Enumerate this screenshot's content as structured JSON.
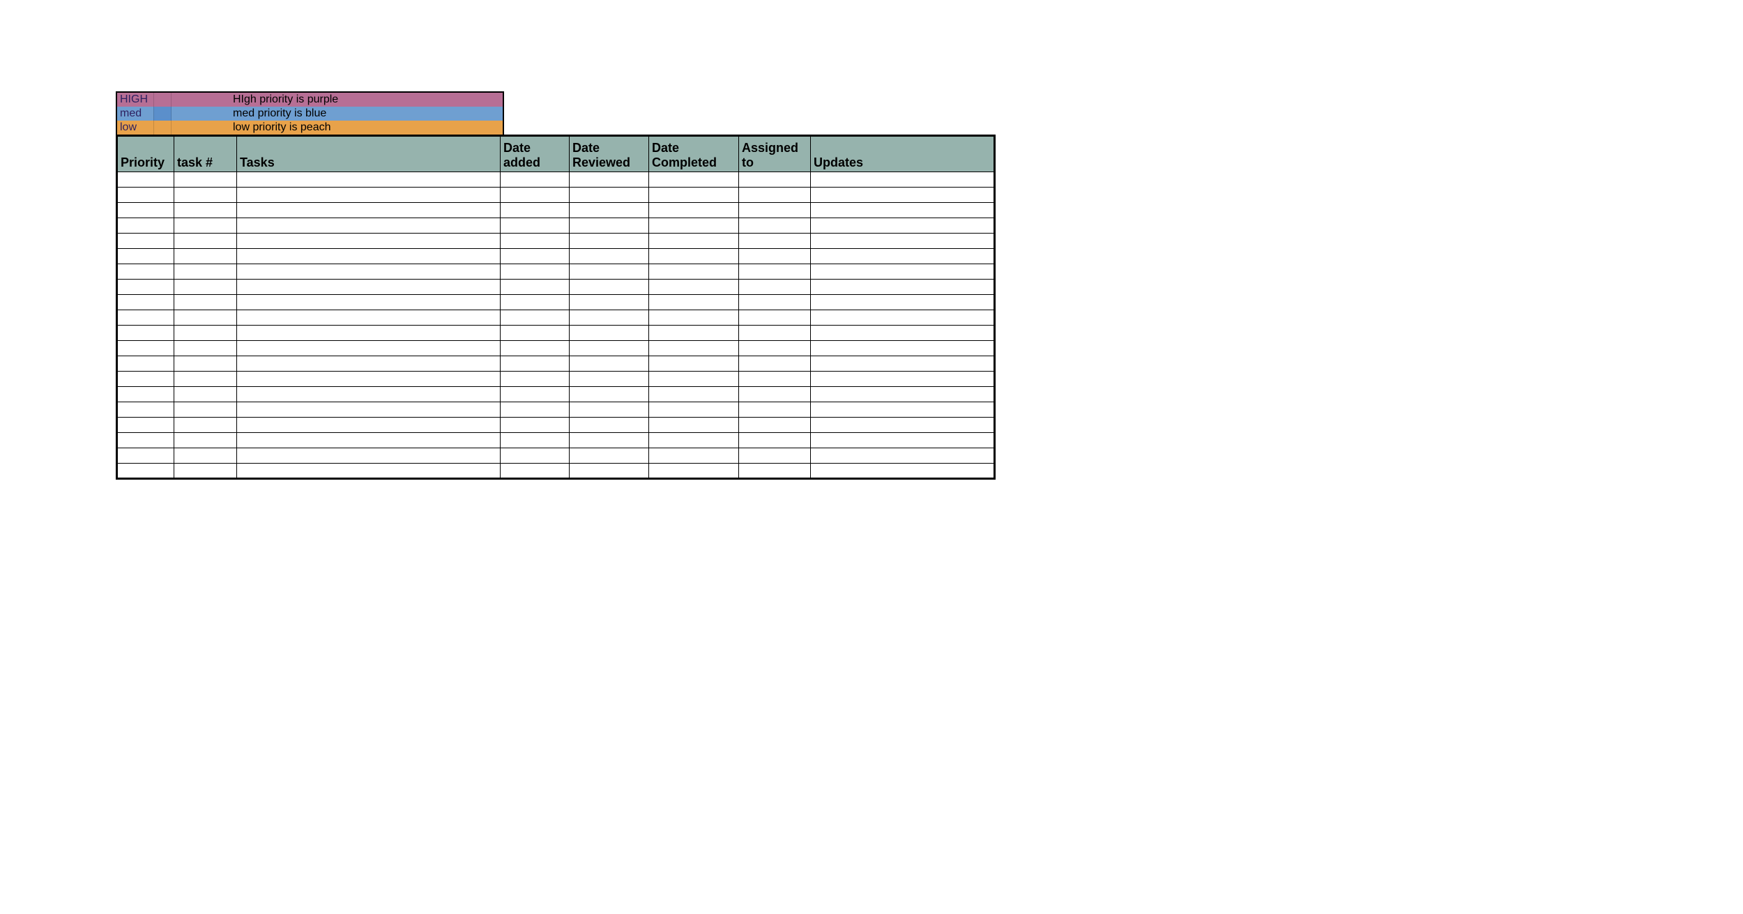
{
  "legend": {
    "high": {
      "label": "HIGH",
      "description": "HIgh priority is purple"
    },
    "med": {
      "label": "med",
      "description": "med priority is blue"
    },
    "low": {
      "label": "low",
      "description": "low priority is peach"
    }
  },
  "columns": {
    "priority": "Priority",
    "task_num": "task #",
    "tasks": "Tasks",
    "date_added": "Date added",
    "date_reviewed": "Date Reviewed",
    "date_completed": "Date Completed",
    "assigned_to": "Assigned to",
    "updates": "Updates"
  },
  "rows": [
    {
      "priority": "",
      "task_num": "",
      "tasks": "",
      "date_added": "",
      "date_reviewed": "",
      "date_completed": "",
      "assigned_to": "",
      "updates": ""
    },
    {
      "priority": "",
      "task_num": "",
      "tasks": "",
      "date_added": "",
      "date_reviewed": "",
      "date_completed": "",
      "assigned_to": "",
      "updates": ""
    },
    {
      "priority": "",
      "task_num": "",
      "tasks": "",
      "date_added": "",
      "date_reviewed": "",
      "date_completed": "",
      "assigned_to": "",
      "updates": ""
    },
    {
      "priority": "",
      "task_num": "",
      "tasks": "",
      "date_added": "",
      "date_reviewed": "",
      "date_completed": "",
      "assigned_to": "",
      "updates": ""
    },
    {
      "priority": "",
      "task_num": "",
      "tasks": "",
      "date_added": "",
      "date_reviewed": "",
      "date_completed": "",
      "assigned_to": "",
      "updates": ""
    },
    {
      "priority": "",
      "task_num": "",
      "tasks": "",
      "date_added": "",
      "date_reviewed": "",
      "date_completed": "",
      "assigned_to": "",
      "updates": ""
    },
    {
      "priority": "",
      "task_num": "",
      "tasks": "",
      "date_added": "",
      "date_reviewed": "",
      "date_completed": "",
      "assigned_to": "",
      "updates": ""
    },
    {
      "priority": "",
      "task_num": "",
      "tasks": "",
      "date_added": "",
      "date_reviewed": "",
      "date_completed": "",
      "assigned_to": "",
      "updates": ""
    },
    {
      "priority": "",
      "task_num": "",
      "tasks": "",
      "date_added": "",
      "date_reviewed": "",
      "date_completed": "",
      "assigned_to": "",
      "updates": ""
    },
    {
      "priority": "",
      "task_num": "",
      "tasks": "",
      "date_added": "",
      "date_reviewed": "",
      "date_completed": "",
      "assigned_to": "",
      "updates": ""
    },
    {
      "priority": "",
      "task_num": "",
      "tasks": "",
      "date_added": "",
      "date_reviewed": "",
      "date_completed": "",
      "assigned_to": "",
      "updates": ""
    },
    {
      "priority": "",
      "task_num": "",
      "tasks": "",
      "date_added": "",
      "date_reviewed": "",
      "date_completed": "",
      "assigned_to": "",
      "updates": ""
    },
    {
      "priority": "",
      "task_num": "",
      "tasks": "",
      "date_added": "",
      "date_reviewed": "",
      "date_completed": "",
      "assigned_to": "",
      "updates": ""
    },
    {
      "priority": "",
      "task_num": "",
      "tasks": "",
      "date_added": "",
      "date_reviewed": "",
      "date_completed": "",
      "assigned_to": "",
      "updates": ""
    },
    {
      "priority": "",
      "task_num": "",
      "tasks": "",
      "date_added": "",
      "date_reviewed": "",
      "date_completed": "",
      "assigned_to": "",
      "updates": ""
    },
    {
      "priority": "",
      "task_num": "",
      "tasks": "",
      "date_added": "",
      "date_reviewed": "",
      "date_completed": "",
      "assigned_to": "",
      "updates": ""
    },
    {
      "priority": "",
      "task_num": "",
      "tasks": "",
      "date_added": "",
      "date_reviewed": "",
      "date_completed": "",
      "assigned_to": "",
      "updates": ""
    },
    {
      "priority": "",
      "task_num": "",
      "tasks": "",
      "date_added": "",
      "date_reviewed": "",
      "date_completed": "",
      "assigned_to": "",
      "updates": ""
    },
    {
      "priority": "",
      "task_num": "",
      "tasks": "",
      "date_added": "",
      "date_reviewed": "",
      "date_completed": "",
      "assigned_to": "",
      "updates": ""
    },
    {
      "priority": "",
      "task_num": "",
      "tasks": "",
      "date_added": "",
      "date_reviewed": "",
      "date_completed": "",
      "assigned_to": "",
      "updates": ""
    }
  ]
}
